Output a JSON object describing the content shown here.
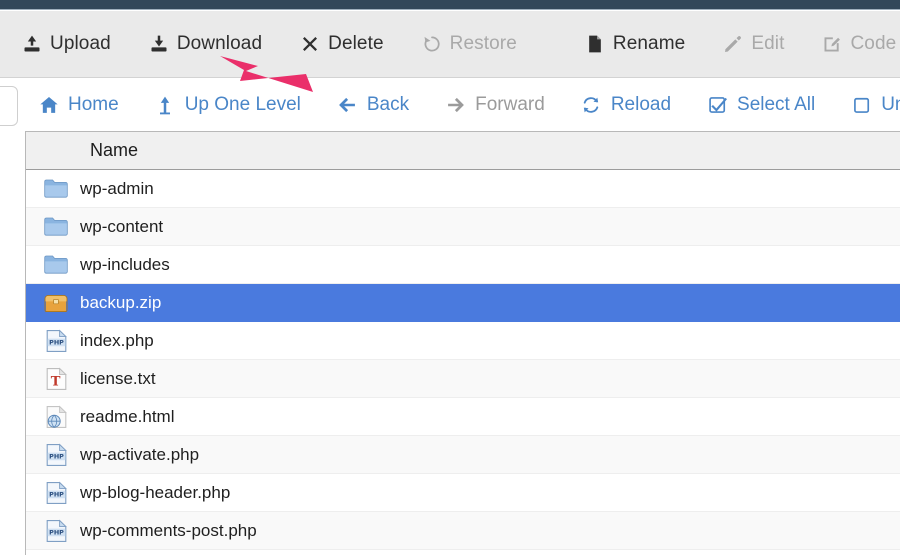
{
  "window": {
    "accent_navy": "#32485a",
    "toolbar_bg": "#eaeaea",
    "link_blue": "#4a86c8",
    "selection_blue": "#4a7ade",
    "annotation_color": "#ea2f6a"
  },
  "toolbar": {
    "items": [
      {
        "label": "Upload",
        "icon": "upload-icon",
        "disabled": false
      },
      {
        "label": "Download",
        "icon": "download-icon",
        "disabled": false
      },
      {
        "label": "Delete",
        "icon": "delete-x-icon",
        "disabled": false
      },
      {
        "label": "Restore",
        "icon": "restore-icon",
        "disabled": true
      },
      {
        "label": "Rename",
        "icon": "file-icon",
        "disabled": false
      },
      {
        "label": "Edit",
        "icon": "pencil-icon",
        "disabled": true
      },
      {
        "label": "Code Editor",
        "icon": "code-editor-icon",
        "disabled": true
      }
    ]
  },
  "navbar": {
    "items": [
      {
        "label": "Home",
        "icon": "home-icon",
        "disabled": false
      },
      {
        "label": "Up One Level",
        "icon": "up-level-icon",
        "disabled": false
      },
      {
        "label": "Back",
        "icon": "arrow-left-icon",
        "disabled": false
      },
      {
        "label": "Forward",
        "icon": "arrow-right-icon",
        "disabled": true
      },
      {
        "label": "Reload",
        "icon": "reload-icon",
        "disabled": false
      },
      {
        "label": "Select All",
        "icon": "checked-box-icon",
        "disabled": false
      },
      {
        "label": "Unselect All",
        "icon": "unchecked-box-icon",
        "disabled": false
      }
    ]
  },
  "filelist": {
    "column_header": "Name",
    "rows": [
      {
        "name": "wp-admin",
        "icon": "folder-icon",
        "selected": false
      },
      {
        "name": "wp-content",
        "icon": "folder-icon",
        "selected": false
      },
      {
        "name": "wp-includes",
        "icon": "folder-icon",
        "selected": false
      },
      {
        "name": "backup.zip",
        "icon": "archive-icon",
        "selected": true
      },
      {
        "name": "index.php",
        "icon": "php-icon",
        "selected": false
      },
      {
        "name": "license.txt",
        "icon": "text-icon",
        "selected": false
      },
      {
        "name": "readme.html",
        "icon": "html-icon",
        "selected": false
      },
      {
        "name": "wp-activate.php",
        "icon": "php-icon",
        "selected": false
      },
      {
        "name": "wp-blog-header.php",
        "icon": "php-icon",
        "selected": false
      },
      {
        "name": "wp-comments-post.php",
        "icon": "php-icon",
        "selected": false
      }
    ]
  },
  "annotation": {
    "type": "arrow",
    "points_to": "Download",
    "color": "#ea2f6a"
  }
}
